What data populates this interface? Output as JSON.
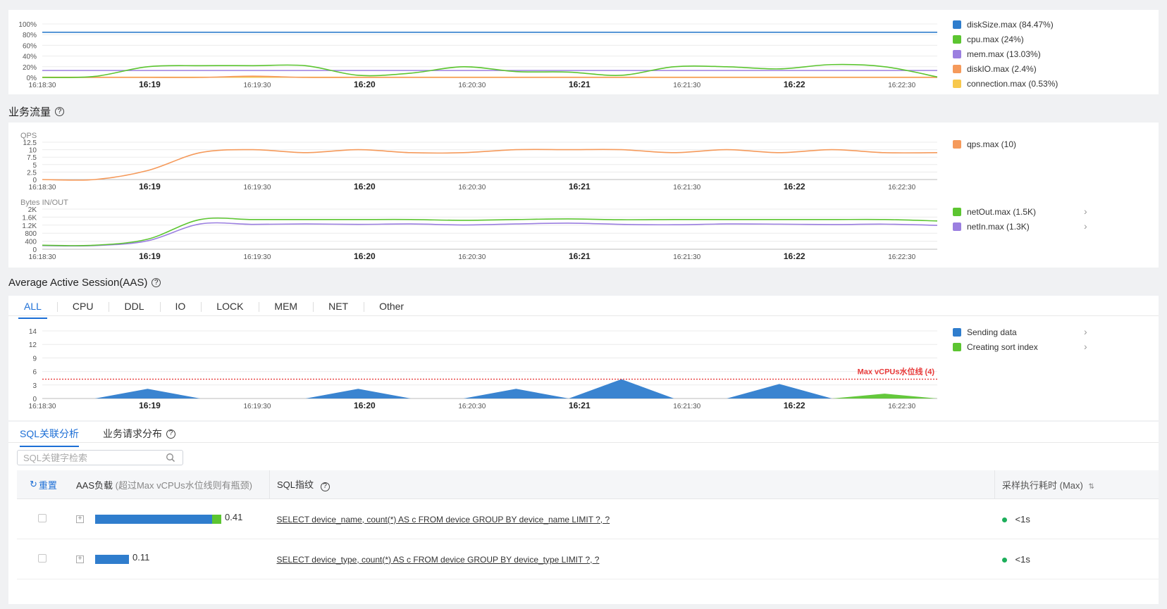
{
  "x_ticks": [
    "16:18:30",
    "16:19",
    "16:19:30",
    "16:20",
    "16:20:30",
    "16:21",
    "16:21:30",
    "16:22",
    "16:22:30"
  ],
  "colors": {
    "blue": "#2f7dcd",
    "green": "#5cc531",
    "purple": "#9b7fe0",
    "orange": "#f59a5b",
    "yellow": "#f7c84d",
    "threshold": "#e83a3a",
    "accent": "#1d6fd6"
  },
  "sections": {
    "business_traffic": "业务流量",
    "aas": "Average Active Session(AAS)"
  },
  "legends": {
    "resource": [
      "diskSize.max (84.47%)",
      "cpu.max (24%)",
      "mem.max (13.03%)",
      "diskIO.max (2.4%)",
      "connection.max (0.53%)"
    ],
    "qps": [
      "qps.max (10)"
    ],
    "bytes": [
      "netOut.max (1.5K)",
      "netIn.max (1.3K)"
    ],
    "aas": [
      "Sending data",
      "Creating sort index"
    ]
  },
  "aas_tabs": [
    "ALL",
    "CPU",
    "DDL",
    "IO",
    "LOCK",
    "MEM",
    "NET",
    "Other"
  ],
  "sub_tabs": [
    "SQL关联分析",
    "业务请求分布"
  ],
  "search": {
    "placeholder": "SQL关键字检索"
  },
  "table": {
    "reset_label": "重置",
    "col_aas": "AAS负载",
    "col_aas_note": "(超过Max vCPUs水位线则有瓶颈)",
    "col_sql": "SQL指纹",
    "col_time": "采样执行耗时 (Max)",
    "rows": [
      {
        "aas_value": "0.41",
        "sql": "SELECT device_name, count(*) AS c FROM device GROUP BY device_name LIMIT ?, ?",
        "time": "<1s"
      },
      {
        "aas_value": "0.11",
        "sql": "SELECT device_type, count(*) AS c FROM device GROUP BY device_type LIMIT ?, ?",
        "time": "<1s"
      }
    ]
  },
  "chart_data": [
    {
      "type": "line",
      "x": [
        "16:18:30",
        "16:18:45",
        "16:19",
        "16:19:15",
        "16:19:30",
        "16:19:45",
        "16:20",
        "16:20:15",
        "16:20:30",
        "16:20:45",
        "16:21",
        "16:21:15",
        "16:21:30",
        "16:21:45",
        "16:22",
        "16:22:15",
        "16:22:30",
        "16:22:45"
      ],
      "y_ticks": [
        "0%",
        "20%",
        "40%",
        "60%",
        "80%",
        "100%"
      ],
      "ylim": [
        0,
        100
      ],
      "series": [
        {
          "name": "diskSize.max (84.47%)",
          "values": [
            84.47,
            84.47,
            84.47,
            84.47,
            84.47,
            84.47,
            84.47,
            84.47,
            84.47,
            84.47,
            84.47,
            84.47,
            84.47,
            84.47,
            84.47,
            84.47,
            84.47,
            84.47
          ]
        },
        {
          "name": "cpu.max (24%)",
          "values": [
            0,
            2,
            20,
            22,
            22,
            22,
            4,
            8,
            20,
            11,
            10,
            4,
            20,
            20,
            16,
            24,
            20,
            1
          ]
        },
        {
          "name": "mem.max (13.03%)",
          "values": [
            13,
            13,
            13,
            13,
            13,
            13,
            13,
            13,
            13,
            13,
            13,
            13,
            13,
            13,
            13,
            13,
            13,
            13
          ]
        },
        {
          "name": "diskIO.max (2.4%)",
          "values": [
            0,
            0,
            0,
            0,
            2.4,
            0,
            0,
            0,
            0,
            0,
            0,
            0,
            0,
            0,
            0,
            0,
            0,
            0
          ]
        },
        {
          "name": "connection.max (0.53%)",
          "values": [
            0.5,
            0.5,
            0.5,
            0.5,
            0.5,
            0.5,
            0.5,
            0.5,
            0.5,
            0.5,
            0.5,
            0.5,
            0.5,
            0.5,
            0.5,
            0.5,
            0.5,
            0.5
          ]
        }
      ]
    },
    {
      "type": "line",
      "ylabel": "QPS",
      "x": [
        "16:18:30",
        "16:18:45",
        "16:19",
        "16:19:15",
        "16:19:30",
        "16:19:45",
        "16:20",
        "16:20:15",
        "16:20:30",
        "16:20:45",
        "16:21",
        "16:21:15",
        "16:21:30",
        "16:21:45",
        "16:22",
        "16:22:15",
        "16:22:30",
        "16:22:45"
      ],
      "y_ticks": [
        "0",
        "2.5",
        "5",
        "7.5",
        "10",
        "12.5"
      ],
      "ylim": [
        0,
        12.5
      ],
      "series": [
        {
          "name": "qps.max (10)",
          "values": [
            0,
            0,
            3,
            9,
            10,
            9,
            10,
            9,
            9,
            10,
            10,
            10,
            9,
            10,
            9,
            10,
            9,
            9
          ]
        }
      ]
    },
    {
      "type": "line",
      "ylabel": "Bytes IN/OUT",
      "x": [
        "16:18:30",
        "16:18:45",
        "16:19",
        "16:19:15",
        "16:19:30",
        "16:19:45",
        "16:20",
        "16:20:15",
        "16:20:30",
        "16:20:45",
        "16:21",
        "16:21:15",
        "16:21:30",
        "16:21:45",
        "16:22",
        "16:22:15",
        "16:22:30",
        "16:22:45"
      ],
      "y_ticks": [
        "0",
        "400",
        "800",
        "1.2K",
        "1.6K",
        "2K"
      ],
      "ylim": [
        0,
        2000
      ],
      "series": [
        {
          "name": "netOut.max (1.5K)",
          "values": [
            200,
            200,
            500,
            1480,
            1480,
            1480,
            1480,
            1480,
            1440,
            1480,
            1510,
            1470,
            1480,
            1480,
            1480,
            1480,
            1480,
            1410
          ]
        },
        {
          "name": "netIn.max (1.3K)",
          "values": [
            180,
            180,
            420,
            1260,
            1240,
            1260,
            1240,
            1260,
            1210,
            1260,
            1300,
            1240,
            1220,
            1260,
            1250,
            1230,
            1250,
            1190
          ]
        }
      ]
    },
    {
      "type": "area",
      "x": [
        "16:18:30",
        "16:18:45",
        "16:19",
        "16:19:15",
        "16:19:30",
        "16:19:45",
        "16:20",
        "16:20:15",
        "16:20:30",
        "16:20:45",
        "16:21",
        "16:21:15",
        "16:21:30",
        "16:21:45",
        "16:22",
        "16:22:15",
        "16:22:30",
        "16:22:45"
      ],
      "y_ticks": [
        "0",
        "3",
        "6",
        "9",
        "12",
        "14"
      ],
      "ylim": [
        0,
        14
      ],
      "threshold": {
        "label": "Max vCPUs水位线 (4)",
        "value": 4
      },
      "series": [
        {
          "name": "Sending data",
          "values": [
            0,
            0,
            2,
            0,
            0,
            0,
            2,
            0,
            0,
            2,
            0,
            4,
            0,
            0,
            3,
            0,
            0,
            0
          ]
        },
        {
          "name": "Creating sort index",
          "values": [
            0,
            0,
            0,
            0,
            0,
            0,
            0,
            0,
            0,
            0,
            0,
            0,
            0,
            0,
            0,
            0,
            1,
            0
          ]
        }
      ]
    }
  ]
}
